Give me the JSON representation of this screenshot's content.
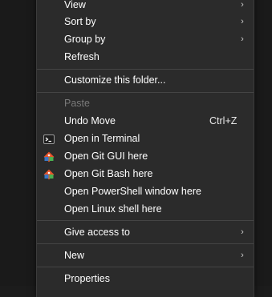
{
  "menu": {
    "view_label": "View",
    "sort_by_label": "Sort by",
    "group_by_label": "Group by",
    "refresh_label": "Refresh",
    "customize_label": "Customize this folder...",
    "paste_label": "Paste",
    "undo_move_label": "Undo Move",
    "undo_move_shortcut": "Ctrl+Z",
    "open_terminal_label": "Open in Terminal",
    "open_git_gui_label": "Open Git GUI here",
    "open_git_bash_label": "Open Git Bash here",
    "open_powershell_label": "Open PowerShell window here",
    "open_linux_shell_label": "Open Linux shell here",
    "give_access_label": "Give access to",
    "new_label": "New",
    "properties_label": "Properties",
    "submenu_arrow": "›"
  },
  "icons": {
    "terminal": "terminal-icon",
    "git_gui": "git-gui-icon",
    "git_bash": "git-bash-icon"
  },
  "colors": {
    "menu_background": "#2b2b2b",
    "text": "#ffffff",
    "disabled_text": "#7a7a7a",
    "separator": "#444444",
    "git_orange": "#e8542b",
    "git_blue": "#3a78c4",
    "git_green": "#4caf50"
  }
}
